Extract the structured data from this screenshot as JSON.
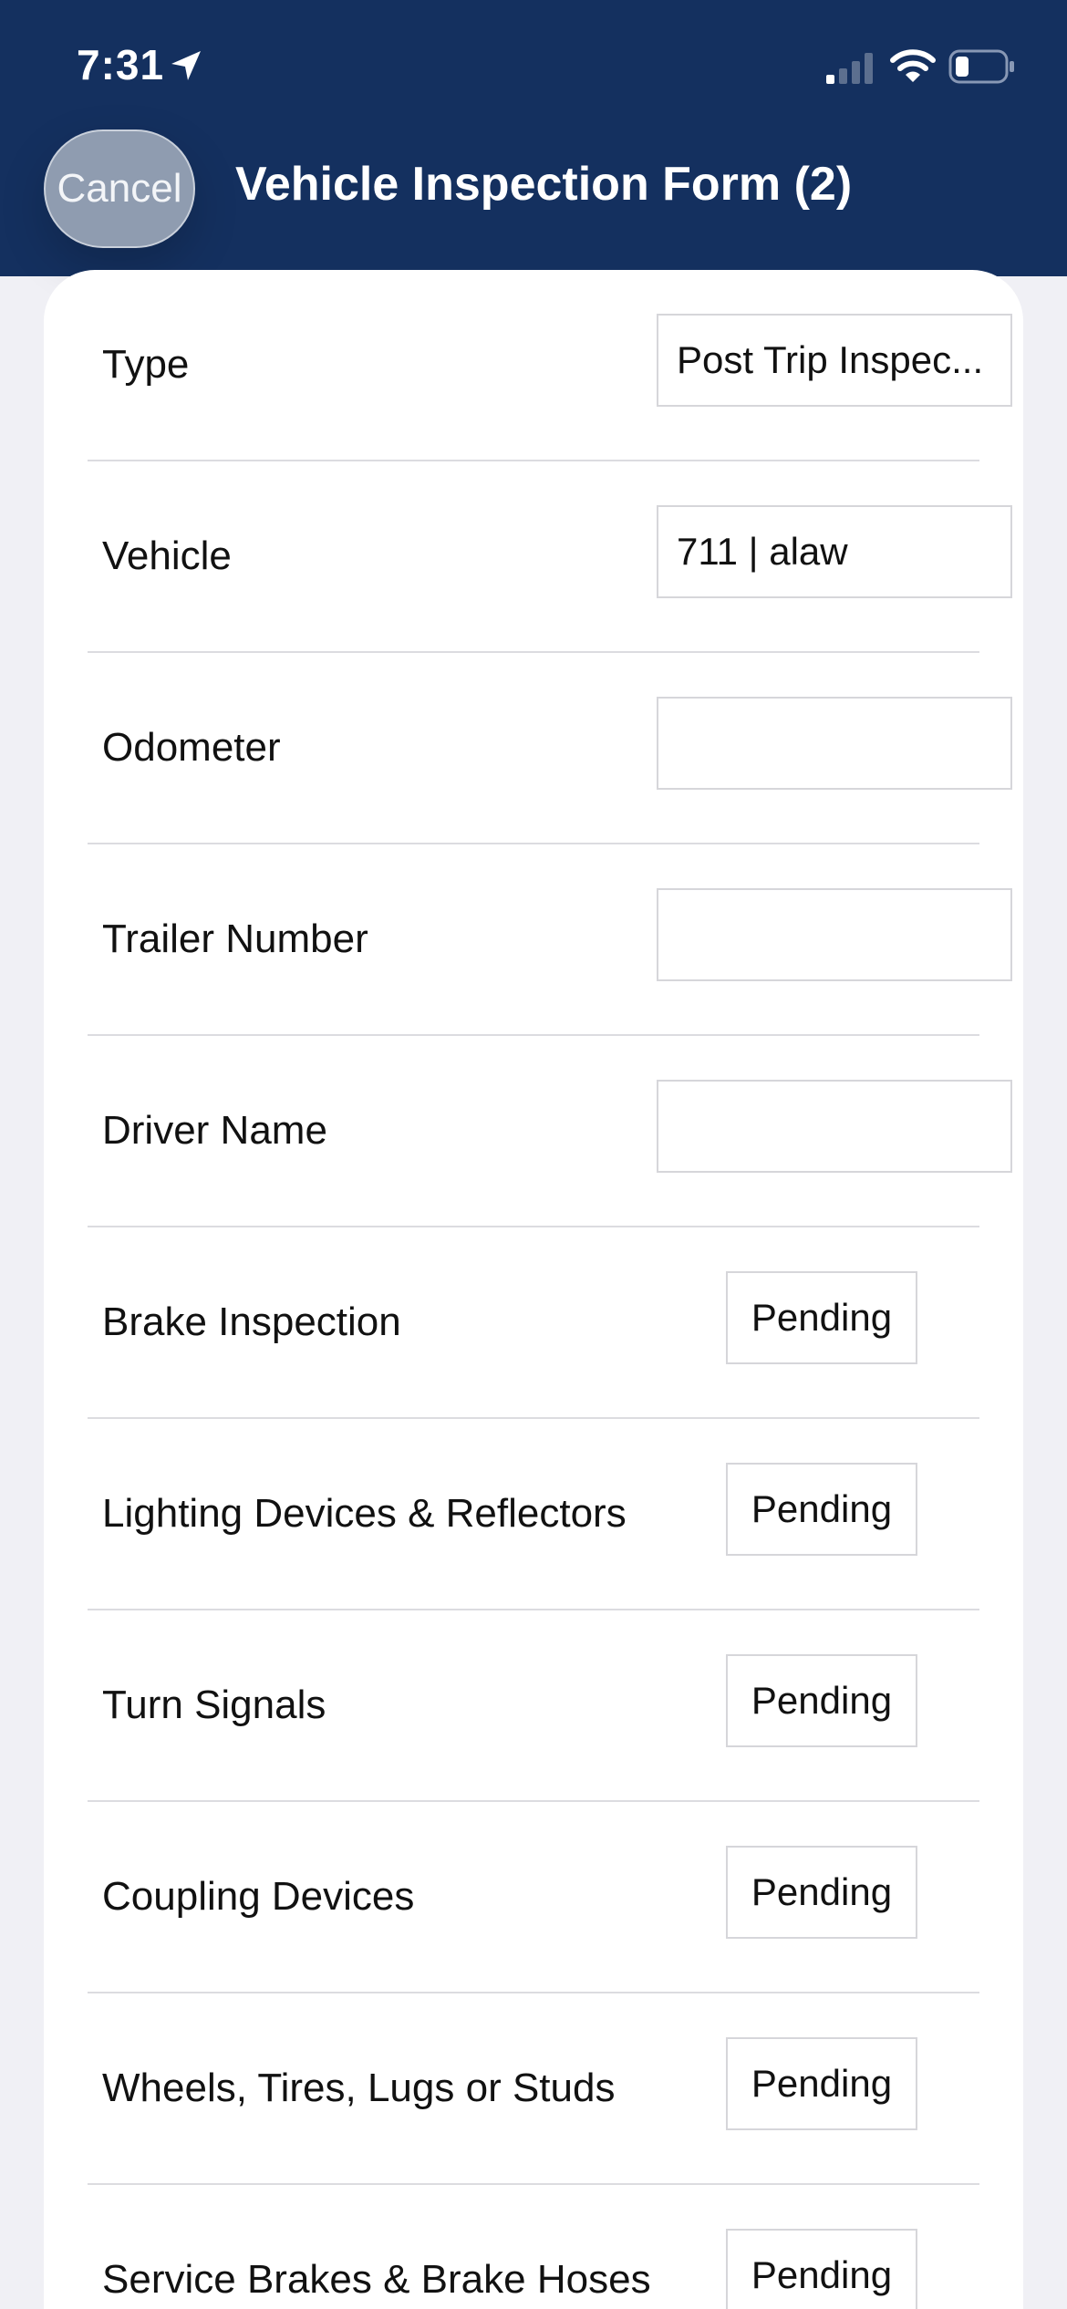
{
  "status_bar": {
    "time": "7:31"
  },
  "header": {
    "cancel_label": "Cancel",
    "title": "Vehicle Inspection Form (2)",
    "bg_color": "#14305f"
  },
  "form": {
    "fields": [
      {
        "label": "Type",
        "value": "Post Trip Inspec..."
      },
      {
        "label": "Vehicle",
        "value": "711 | alaw"
      },
      {
        "label": "Odometer",
        "value": ""
      },
      {
        "label": "Trailer Number",
        "value": ""
      },
      {
        "label": "Driver Name",
        "value": ""
      }
    ],
    "checks": [
      {
        "label": "Brake Inspection",
        "status": "Pending"
      },
      {
        "label": "Lighting Devices & Reflectors",
        "status": "Pending"
      },
      {
        "label": "Turn Signals",
        "status": "Pending"
      },
      {
        "label": "Coupling Devices",
        "status": "Pending"
      },
      {
        "label": "Wheels, Tires, Lugs or Studs",
        "status": "Pending"
      },
      {
        "label": "Service Brakes & Brake Hoses",
        "status": "Pending"
      }
    ]
  },
  "icons": {
    "location": "location-arrow-icon",
    "signal": "cellular-signal-icon",
    "wifi": "wifi-icon",
    "battery": "battery-icon"
  }
}
